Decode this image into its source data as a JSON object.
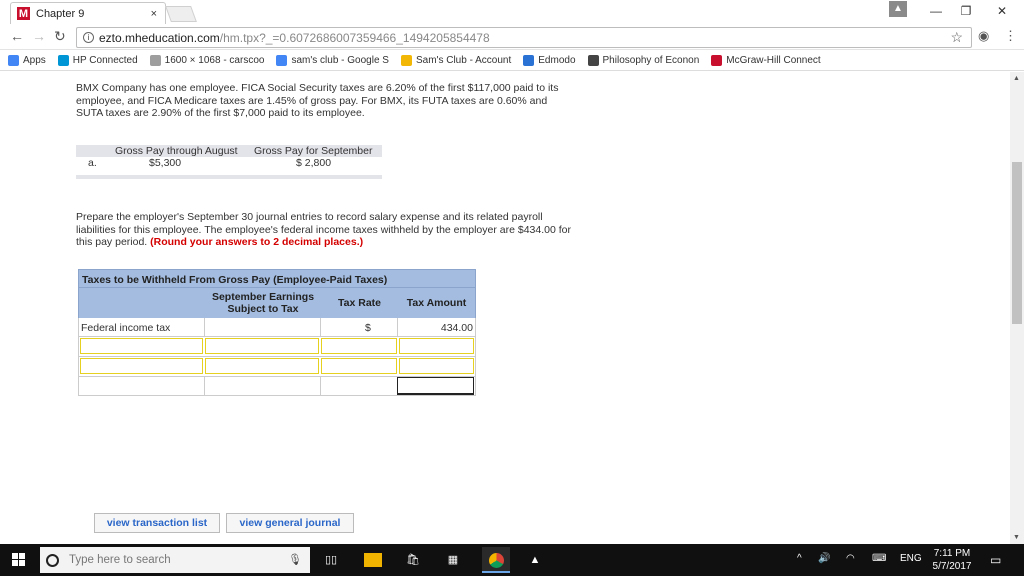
{
  "browser": {
    "tab_title": "Chapter 9",
    "tab_close": "×",
    "url_host": "ezto.mheducation.com",
    "url_rest": "/hm.tpx?_=0.6072686007359466_1494205854478",
    "window_controls": {
      "profile": "▲",
      "minimize": "—",
      "restore": "❐",
      "close": "✕"
    },
    "bookmarks": [
      {
        "label": "Apps",
        "icon": "apps-grid-icon",
        "color": "#4285f4"
      },
      {
        "label": "HP Connected",
        "icon": "hp-icon",
        "color": "#0096d6"
      },
      {
        "label": "1600 × 1068 - carscoo",
        "icon": "page-icon",
        "color": "#9e9e9e"
      },
      {
        "label": "sam's club - Google S",
        "icon": "google-icon",
        "color": "#4285f4"
      },
      {
        "label": "Sam's Club - Account",
        "icon": "sams-club-icon",
        "color": "#f2b705"
      },
      {
        "label": "Edmodo",
        "icon": "edmodo-icon",
        "color": "#2a72d4"
      },
      {
        "label": "Philosophy of Econon",
        "icon": "leaf-icon",
        "color": "#444444"
      },
      {
        "label": "McGraw-Hill Connect",
        "icon": "mcgraw-hill-icon",
        "color": "#c8102e"
      }
    ]
  },
  "problem": {
    "intro": "BMX Company has one employee. FICA Social Security taxes are 6.20% of the first $117,000 paid to its employee, and FICA Medicare taxes are 1.45% of gross pay. For BMX, its FUTA taxes are 0.60% and SUTA taxes are 2.90% of the first $7,000 paid to its employee.",
    "given": {
      "row_label": "a.",
      "col1_header": "Gross Pay through August",
      "col2_header": "Gross Pay for September",
      "col1_value": "$5,300",
      "col2_value": "$ 2,800"
    },
    "instruction": "Prepare the employer's September 30 journal entries to record salary expense and its related payroll liabilities for this employee. The employee's federal income taxes withheld by the employer are $434.00 for this pay period.",
    "instruction_note": "(Round your answers to 2 decimal places.)"
  },
  "tax_table": {
    "title": "Taxes to be Withheld From Gross Pay (Employee-Paid Taxes)",
    "headers": [
      "September Earnings Subject to Tax",
      "Tax Rate",
      "Tax Amount"
    ],
    "rows": [
      {
        "label": "Federal income tax",
        "currency": "$",
        "amount": "434.00"
      }
    ]
  },
  "buttons": {
    "transaction_list": "view transaction list",
    "general_journal": "view general journal"
  },
  "taskbar": {
    "search_placeholder": "Type here to search",
    "language": "ENG",
    "time": "7:11 PM",
    "date": "5/7/2017"
  }
}
